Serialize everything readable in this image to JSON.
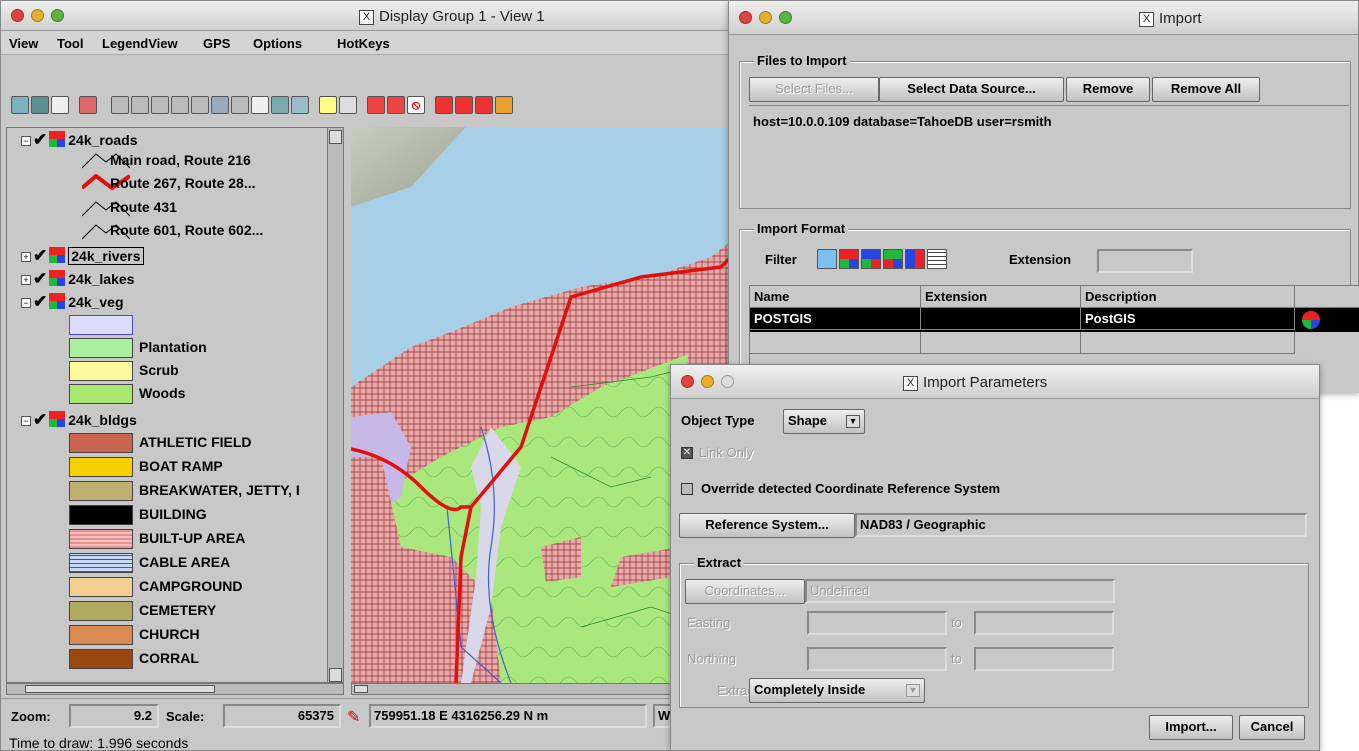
{
  "main_window": {
    "title": "Display Group 1 - View 1",
    "menu": [
      "View",
      "Tool",
      "LegendView",
      "GPS",
      "Options",
      "HotKeys"
    ],
    "layers": [
      {
        "name": "24k_roads",
        "expanded": true
      },
      {
        "name": "24k_rivers",
        "expanded": false
      },
      {
        "name": "24k_lakes",
        "expanded": false
      },
      {
        "name": "24k_veg",
        "expanded": true
      },
      {
        "name": "24k_bldgs",
        "expanded": true
      }
    ],
    "road_legend": [
      "Main road, Route 216",
      "Route 267, Route 28...",
      "Route 431",
      "Route 601, Route 602..."
    ],
    "veg_legend": [
      {
        "label": "",
        "color": "#dcdcff"
      },
      {
        "label": "Plantation",
        "color": "#a8f0a0"
      },
      {
        "label": "Scrub",
        "color": "#fafa9c"
      },
      {
        "label": "Woods",
        "color": "#a8e870"
      }
    ],
    "bldg_legend": [
      {
        "label": "ATHLETIC FIELD",
        "color": "#c86450"
      },
      {
        "label": "BOAT RAMP",
        "color": "#f8d000"
      },
      {
        "label": "BREAKWATER, JETTY, I",
        "color": "#c0b070"
      },
      {
        "label": "BUILDING",
        "color": "#000000"
      },
      {
        "label": "BUILT-UP AREA",
        "color": "#e89090"
      },
      {
        "label": "CABLE AREA",
        "color": "#c8d8f8"
      },
      {
        "label": "CAMPGROUND",
        "color": "#f0d090"
      },
      {
        "label": "CEMETERY",
        "color": "#b0aa60"
      },
      {
        "label": "CHURCH",
        "color": "#d88a50"
      },
      {
        "label": "CORRAL",
        "color": "#9a4810"
      }
    ],
    "status": {
      "zoom_label": "Zoom:",
      "zoom_value": "9.2",
      "scale_label": "Scale:",
      "scale_value": "65375",
      "coords": "759951.18 E  4316256.29 N m",
      "extra": "W",
      "time_to_draw": "Time to draw: 1.996 seconds"
    }
  },
  "import_window": {
    "title": "Import",
    "files_group": "Files to Import",
    "buttons": {
      "select_files": "Select Files...",
      "select_source": "Select Data Source...",
      "remove": "Remove",
      "remove_all": "Remove All"
    },
    "file_list": [
      "host=10.0.0.109  database=TahoeDB  user=rsmith"
    ],
    "format_group": "Import Format",
    "filter_label": "Filter",
    "extension_label": "Extension",
    "extension_value": "",
    "columns": [
      "Name",
      "Extension",
      "Description"
    ],
    "rows": [
      {
        "name": "POSTGIS",
        "extension": "",
        "description": "PostGIS"
      }
    ]
  },
  "params_window": {
    "title": "Import Parameters",
    "object_type_label": "Object Type",
    "object_type_value": "Shape",
    "link_only_label": "Link Only",
    "override_label": "Override detected Coordinate Reference System",
    "refsys_button": "Reference System...",
    "refsys_value": "NAD83 / Geographic",
    "extract_group": "Extract",
    "coordinates_button": "Coordinates...",
    "coordinates_value": "Undefined",
    "easting_label": "Easting",
    "northing_label": "Northing",
    "to_label": "to",
    "extract_label": "Extract",
    "extract_value": "Completely Inside",
    "import_button": "Import...",
    "cancel_button": "Cancel"
  },
  "colors": {
    "route_red": "#e01010",
    "selection": "#000000"
  }
}
